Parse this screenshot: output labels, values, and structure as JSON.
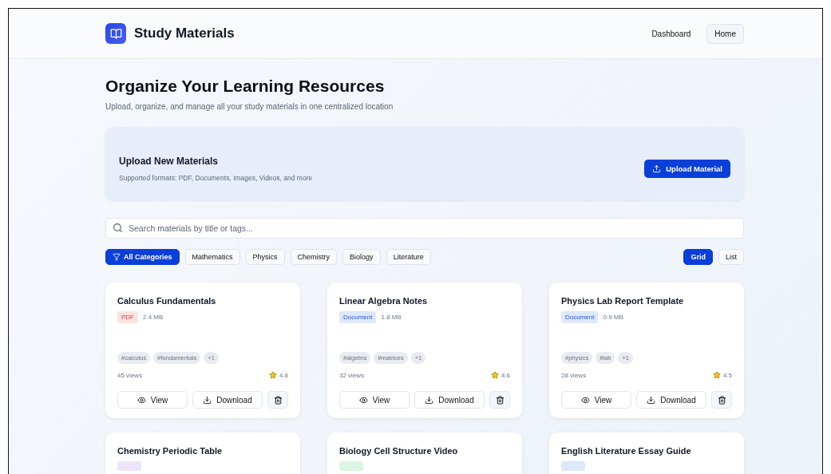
{
  "header": {
    "title": "Study Materials",
    "nav": [
      {
        "label": "Dashboard",
        "selected": false
      },
      {
        "label": "Home",
        "selected": true
      }
    ]
  },
  "hero": {
    "title": "Organize Your Learning Resources",
    "subtitle": "Upload, organize, and manage all your study materials in one centralized location"
  },
  "upload": {
    "title": "Upload New Materials",
    "subtitle": "Supported formats: PDF, Documents, Images, Videos, and more",
    "button": "Upload Material"
  },
  "search": {
    "placeholder": "Search materials by title or tags..."
  },
  "categories": [
    {
      "label": "All Categories",
      "selected": true
    },
    {
      "label": "Mathematics",
      "selected": false
    },
    {
      "label": "Physics",
      "selected": false
    },
    {
      "label": "Chemistry",
      "selected": false
    },
    {
      "label": "Biology",
      "selected": false
    },
    {
      "label": "Literature",
      "selected": false
    }
  ],
  "views": [
    {
      "label": "Grid",
      "selected": true
    },
    {
      "label": "List",
      "selected": false
    }
  ],
  "materials": [
    {
      "title": "Calculus Fundamentals",
      "type": "PDF",
      "kind": "pdf",
      "size": "2.4 MB",
      "tags": [
        "#calculus",
        "#fundamentals",
        "+1"
      ],
      "views": "45 views",
      "rating": "4.8",
      "actions": [
        "View",
        "Download"
      ]
    },
    {
      "title": "Linear Algebra Notes",
      "type": "Document",
      "kind": "document",
      "size": "1.8 MB",
      "tags": [
        "#algebra",
        "#matrices",
        "+1"
      ],
      "views": "32 views",
      "rating": "4.6",
      "actions": [
        "View",
        "Download"
      ]
    },
    {
      "title": "Physics Lab Report Template",
      "type": "Document",
      "kind": "document",
      "size": "0.9 MB",
      "tags": [
        "#physics",
        "#lab",
        "+1"
      ],
      "views": "28 views",
      "rating": "4.5",
      "actions": [
        "View",
        "Download"
      ]
    },
    {
      "title": "Chemistry Periodic Table",
      "kind": "image"
    },
    {
      "title": "Biology Cell Structure Video",
      "kind": "video"
    },
    {
      "title": "English Literature Essay Guide",
      "kind": "document"
    }
  ]
}
